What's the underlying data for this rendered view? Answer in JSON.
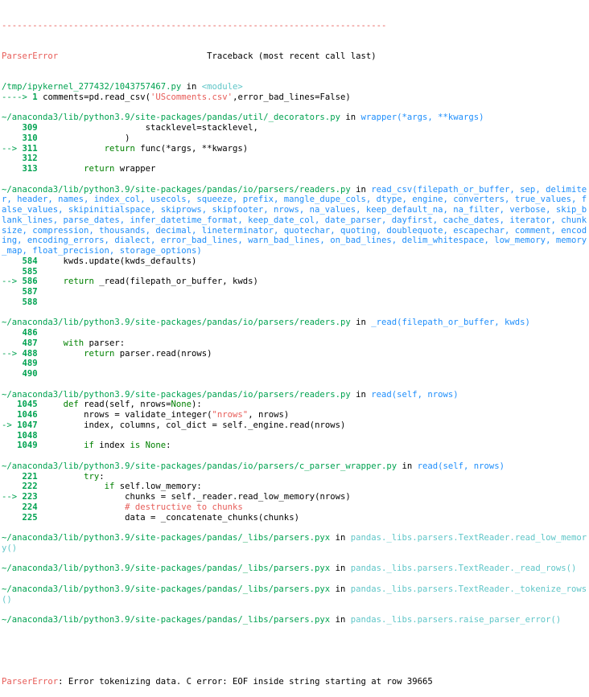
{
  "header": {
    "separator": "---------------------------------------------------------------------------",
    "error_name": "ParserError",
    "traceback_label": "Traceback (most recent call last)"
  },
  "frames": [
    {
      "file": "/tmp/ipykernel_277432/1043757467.py",
      "in": " in ",
      "func": "<module>",
      "lines": [
        {
          "arrow": "----> ",
          "no": "1",
          "code": "comments=pd.read_csv('UScomments.csv',error_bad_lines=False)"
        }
      ]
    },
    {
      "file": "~/anaconda3/lib/python3.9/site-packages/pandas/util/_decorators.py",
      "in": " in ",
      "func": "wrapper(*args, **kwargs)",
      "lines": [
        {
          "arrow": "    ",
          "no": "309",
          "code": "                    stacklevel=stacklevel,"
        },
        {
          "arrow": "    ",
          "no": "310",
          "code": "                )"
        },
        {
          "arrow": "--> ",
          "no": "311",
          "code": "            return func(*args, **kwargs)"
        },
        {
          "arrow": "    ",
          "no": "312",
          "code": ""
        },
        {
          "arrow": "    ",
          "no": "313",
          "code": "        return wrapper"
        }
      ]
    },
    {
      "file": "~/anaconda3/lib/python3.9/site-packages/pandas/io/parsers/readers.py",
      "in": " in ",
      "func": "read_csv(filepath_or_buffer, sep, delimiter, header, names, index_col, usecols, squeeze, prefix, mangle_dupe_cols, dtype, engine, converters, true_values, false_values, skipinitialspace, skiprows, skipfooter, nrows, na_values, keep_default_na, na_filter, verbose, skip_blank_lines, parse_dates, infer_datetime_format, keep_date_col, date_parser, dayfirst, cache_dates, iterator, chunksize, compression, thousands, decimal, lineterminator, quotechar, quoting, doublequote, escapechar, comment, encoding, encoding_errors, dialect, error_bad_lines, warn_bad_lines, on_bad_lines, delim_whitespace, low_memory, memory_map, float_precision, storage_options)",
      "wrapped": [
        "~/anaconda3/lib/python3.9/site-packages/pandas/io/parsers/readers.py in |read_csv(filepath_or_buffer, sep, delimite",
        "r, header, names, index_col, usecols, squeeze, prefix, mangle_dupe_cols, dtype, engine, converters, true_values, f",
        "alse_values, skipinitialspace, skiprows, skipfooter, nrows, na_values, keep_default_na, na_filter, verbose, skip_b",
        "lank_lines, parse_dates, infer_datetime_format, keep_date_col, date_parser, dayfirst, cache_dates, iterator, chunk",
        "size, compression, thousands, decimal, lineterminator, quotechar, quoting, doublequote, escapechar, comment, encod",
        "ing, encoding_errors, dialect, error_bad_lines, warn_bad_lines, on_bad_lines, delim_whitespace, low_memory, memory",
        "_map, float_precision, storage_options)"
      ],
      "lines": [
        {
          "arrow": "    ",
          "no": "584",
          "code": "    kwds.update(kwds_defaults)"
        },
        {
          "arrow": "    ",
          "no": "585",
          "code": ""
        },
        {
          "arrow": "--> ",
          "no": "586",
          "code": "    return _read(filepath_or_buffer, kwds)"
        },
        {
          "arrow": "    ",
          "no": "587",
          "code": ""
        },
        {
          "arrow": "    ",
          "no": "588",
          "code": ""
        }
      ]
    },
    {
      "file": "~/anaconda3/lib/python3.9/site-packages/pandas/io/parsers/readers.py",
      "in": " in ",
      "func": "_read(filepath_or_buffer, kwds)",
      "lines": [
        {
          "arrow": "    ",
          "no": "486",
          "code": ""
        },
        {
          "arrow": "    ",
          "no": "487",
          "code": "    with parser:"
        },
        {
          "arrow": "--> ",
          "no": "488",
          "code": "        return parser.read(nrows)"
        },
        {
          "arrow": "    ",
          "no": "489",
          "code": ""
        },
        {
          "arrow": "    ",
          "no": "490",
          "code": ""
        }
      ]
    },
    {
      "file": "~/anaconda3/lib/python3.9/site-packages/pandas/io/parsers/readers.py",
      "in": " in ",
      "func": "read(self, nrows)",
      "lines": [
        {
          "arrow": "   ",
          "no": "1045",
          "code": "    def read(self, nrows=None):"
        },
        {
          "arrow": "   ",
          "no": "1046",
          "code": "        nrows = validate_integer(\"nrows\", nrows)"
        },
        {
          "arrow": "-> ",
          "no": "1047",
          "code": "        index, columns, col_dict = self._engine.read(nrows)"
        },
        {
          "arrow": "   ",
          "no": "1048",
          "code": ""
        },
        {
          "arrow": "   ",
          "no": "1049",
          "code": "        if index is None:"
        }
      ]
    },
    {
      "file": "~/anaconda3/lib/python3.9/site-packages/pandas/io/parsers/c_parser_wrapper.py",
      "in": " in ",
      "func": "read(self, nrows)",
      "lines": [
        {
          "arrow": "    ",
          "no": "221",
          "code": "        try:"
        },
        {
          "arrow": "    ",
          "no": "222",
          "code": "            if self.low_memory:"
        },
        {
          "arrow": "--> ",
          "no": "223",
          "code": "                chunks = self._reader.read_low_memory(nrows)"
        },
        {
          "arrow": "    ",
          "no": "224",
          "code": "                # destructive to chunks"
        },
        {
          "arrow": "    ",
          "no": "225",
          "code": "                data = _concatenate_chunks(chunks)"
        }
      ]
    },
    {
      "file": "~/anaconda3/lib/python3.9/site-packages/pandas/_libs/parsers.pyx",
      "in": " in ",
      "func": "pandas._libs.parsers.TextReader.read_low_memory()",
      "wrapped": [
        "~/anaconda3/lib/python3.9/site-packages/pandas/_libs/parsers.pyx in |pandas._libs.parsers.TextReader.read_low_memor",
        "y()"
      ],
      "lines": []
    },
    {
      "file": "~/anaconda3/lib/python3.9/site-packages/pandas/_libs/parsers.pyx",
      "in": " in ",
      "func": "pandas._libs.parsers.TextReader._read_rows()",
      "lines": []
    },
    {
      "file": "~/anaconda3/lib/python3.9/site-packages/pandas/_libs/parsers.pyx",
      "in": " in ",
      "func": "pandas._libs.parsers.TextReader._tokenize_rows()",
      "wrapped": [
        "~/anaconda3/lib/python3.9/site-packages/pandas/_libs/parsers.pyx in |pandas._libs.parsers.TextReader._tokenize_rows",
        "()"
      ],
      "lines": []
    },
    {
      "file": "~/anaconda3/lib/python3.9/site-packages/pandas/_libs/parsers.pyx",
      "in": " in ",
      "func": "pandas._libs.parsers.raise_parser_error()",
      "lines": []
    }
  ],
  "footer": {
    "error_name": "ParserError",
    "message": ": Error tokenizing data. C error: EOF inside string starting at row 39665"
  },
  "colors": {
    "error_red": "#e75c58",
    "path_green": "#00a250",
    "func_cyan": "#60c6c8",
    "func_blue": "#208ffb",
    "keyword_green": "#008000"
  }
}
